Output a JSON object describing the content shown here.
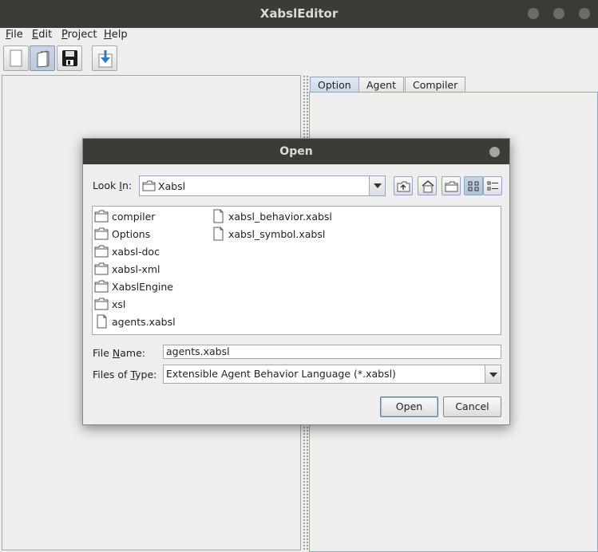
{
  "window": {
    "title": "XabslEditor"
  },
  "menubar": [
    {
      "mnemonic": "F",
      "rest": "ile"
    },
    {
      "mnemonic": "E",
      "rest": "dit"
    },
    {
      "mnemonic": "P",
      "rest": "roject"
    },
    {
      "mnemonic": "H",
      "rest": "elp"
    }
  ],
  "toolbar": {
    "icons": [
      "new-file-icon",
      "open-file-icon",
      "save-icon",
      "import-icon"
    ]
  },
  "tabs": [
    "Option",
    "Agent",
    "Compiler"
  ],
  "dialog": {
    "title": "Open",
    "look_in_label": "Look ",
    "look_in_mnemonic": "I",
    "look_in_suffix": "n:",
    "look_in_value": "Xabsl",
    "file_name_label_pre": "File ",
    "file_name_mnemonic": "N",
    "file_name_label_post": "ame:",
    "file_name_value": "agents.xabsl",
    "files_of_type_label_pre": "Files of ",
    "files_of_type_mnemonic": "T",
    "files_of_type_label_post": "ype:",
    "files_of_type_value": "Extensible Agent Behavior Language (*.xabsl)",
    "open_button": "Open",
    "cancel_button": "Cancel",
    "files": [
      {
        "name": "compiler",
        "type": "folder"
      },
      {
        "name": "Options",
        "type": "folder"
      },
      {
        "name": "xabsl-doc",
        "type": "folder"
      },
      {
        "name": "xabsl-xml",
        "type": "folder"
      },
      {
        "name": "XabslEngine",
        "type": "folder"
      },
      {
        "name": "xsl",
        "type": "folder"
      },
      {
        "name": "agents.xabsl",
        "type": "file"
      },
      {
        "name": "xabsl_behavior.xabsl",
        "type": "file"
      },
      {
        "name": "xabsl_symbol.xabsl",
        "type": "file"
      }
    ]
  }
}
